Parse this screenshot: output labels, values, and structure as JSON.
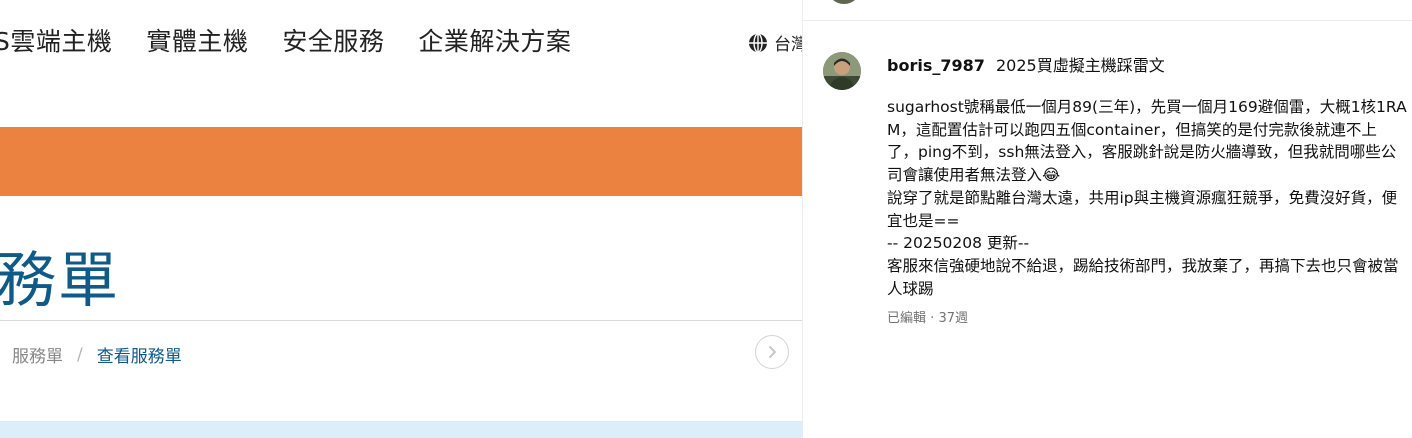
{
  "site": {
    "nav": [
      "S雲端主機",
      "實體主機",
      "安全服務",
      "企業解決方案"
    ],
    "lang_label": "台灣",
    "page_title": "務單",
    "breadcrumb": {
      "parent": "服務單",
      "separator": "/",
      "current": "查看服務單"
    },
    "colors": {
      "orange_band": "#ec8240",
      "title_blue": "#0f5a87",
      "bottom_band": "#dceef9"
    },
    "icons": {
      "globe": "globe-icon",
      "next": "chevron-right-icon"
    }
  },
  "comment": {
    "username": "boris_7987",
    "post_title": "2025買虛擬主機踩雷文",
    "body": "sugarhost號稱最低一個月89(三年)，先買一個月169避個雷，大概1核1RAM，這配置估計可以跑四五個container，但搞笑的是付完款後就連不上了，ping不到，ssh無法登入，客服跳針說是防火牆導致，但我就問哪些公司會讓使用者無法登入😂\n說穿了就是節點離台灣太遠，共用ip與主機資源瘋狂競爭，免費沒好貨，便宜也是==\n-- 20250208 更新--\n客服來信強硬地說不給退，踢給技術部門，我放棄了，再搞下去也只會被當人球踢",
    "edited_label": "已編輯",
    "meta_separator": "·",
    "age": "37週"
  }
}
